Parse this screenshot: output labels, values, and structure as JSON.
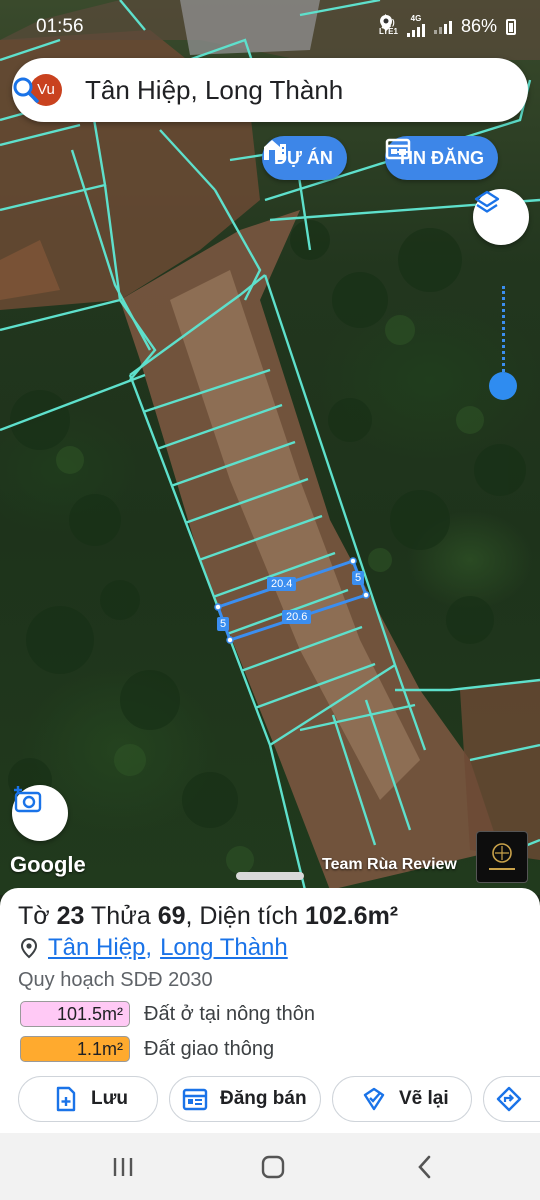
{
  "status_bar": {
    "time": "01:56",
    "network_top": "Vo)",
    "network_bottom": "LTE1",
    "network_type": "4G",
    "battery": "86%"
  },
  "search": {
    "avatar": "Vu",
    "query": "Tân Hiệp, Long Thành",
    "icon": "search-icon"
  },
  "chips": {
    "project": "DỰ ÁN",
    "listing": "TIN ĐĂNG"
  },
  "map": {
    "google_logo": "Google",
    "watermark": "Team Rùa Review",
    "measurements": {
      "top": "20.4",
      "bottom": "20.6",
      "right": "5",
      "left": "5"
    },
    "colors": {
      "parcel_lines": "#5ee0cc",
      "selected_parcel": "#3b8ef0"
    }
  },
  "parcel": {
    "title_prefix": "Tờ ",
    "sheet_no": "23",
    "title_mid": " Thửa ",
    "plot_no": "69",
    "title_area_label": ", Diện tích ",
    "area": "102.6m²",
    "ward": "Tân Hiệp",
    "separator": ",",
    "district": "Long Thành",
    "plan_label": "Quy hoạch SDĐ 2030",
    "zones": [
      {
        "area": "101.5m²",
        "label": "Đất ở tại nông thôn",
        "color": "#ffc9f5"
      },
      {
        "area": "1.1m²",
        "label": "Đất giao thông",
        "color": "#ffaa2e"
      }
    ]
  },
  "actions": {
    "save": "Lưu",
    "sell": "Đăng bán",
    "redraw": "Vẽ lại"
  }
}
